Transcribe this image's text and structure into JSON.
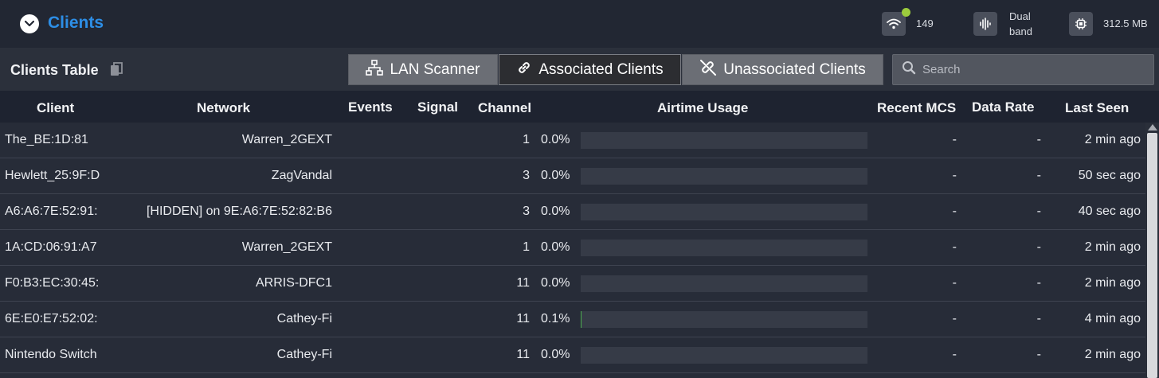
{
  "header": {
    "title": "Clients",
    "collapse_icon": "chevron-down-icon",
    "stats": {
      "wifi_count": "149",
      "band_line1": "Dual",
      "band_line2": "band",
      "memory": "312.5 MB"
    },
    "status_dot_color": "#9ccc3d",
    "accent_color": "#2d8ee6"
  },
  "toolbar": {
    "title": "Clients Table",
    "tabs": [
      {
        "label": "LAN Scanner",
        "icon": "network-icon",
        "active": false
      },
      {
        "label": "Associated Clients",
        "icon": "link-icon",
        "active": true
      },
      {
        "label": "Unassociated Clients",
        "icon": "unlink-icon",
        "active": false
      }
    ],
    "search_placeholder": "Search"
  },
  "table": {
    "columns": [
      "Client",
      "Network",
      "Events",
      "Signal",
      "Channel",
      "Airtime Usage",
      "Recent MCS",
      "Data Rate",
      "Last Seen"
    ],
    "rows": [
      {
        "client": "The_BE:1D:81",
        "network": "Warren_2GEXT",
        "events": "",
        "signal": "",
        "channel": "1",
        "airtime": "0.0%",
        "airtime_fraction": 0.0,
        "mcs": "-",
        "rate": "-",
        "last_seen": "2 min ago"
      },
      {
        "client": "Hewlett_25:9F:D",
        "network": "ZagVandal",
        "events": "",
        "signal": "",
        "channel": "3",
        "airtime": "0.0%",
        "airtime_fraction": 0.0,
        "mcs": "-",
        "rate": "-",
        "last_seen": "50 sec ago"
      },
      {
        "client": "A6:A6:7E:52:91:",
        "network": "[HIDDEN] on 9E:A6:7E:52:82:B6",
        "events": "",
        "signal": "",
        "channel": "3",
        "airtime": "0.0%",
        "airtime_fraction": 0.0,
        "mcs": "-",
        "rate": "-",
        "last_seen": "40 sec ago"
      },
      {
        "client": "1A:CD:06:91:A7",
        "network": "Warren_2GEXT",
        "events": "",
        "signal": "",
        "channel": "1",
        "airtime": "0.0%",
        "airtime_fraction": 0.0,
        "mcs": "-",
        "rate": "-",
        "last_seen": "2 min ago"
      },
      {
        "client": "F0:B3:EC:30:45:",
        "network": "ARRIS-DFC1",
        "events": "",
        "signal": "",
        "channel": "11",
        "airtime": "0.0%",
        "airtime_fraction": 0.0,
        "mcs": "-",
        "rate": "-",
        "last_seen": "2 min ago"
      },
      {
        "client": "6E:E0:E7:52:02:",
        "network": "Cathey-Fi",
        "events": "",
        "signal": "",
        "channel": "11",
        "airtime": "0.1%",
        "airtime_fraction": 0.001,
        "mcs": "-",
        "rate": "-",
        "last_seen": "4 min ago"
      },
      {
        "client": "Nintendo Switch",
        "network": "Cathey-Fi",
        "events": "",
        "signal": "",
        "channel": "11",
        "airtime": "0.0%",
        "airtime_fraction": 0.0,
        "mcs": "-",
        "rate": "-",
        "last_seen": "2 min ago"
      }
    ]
  }
}
